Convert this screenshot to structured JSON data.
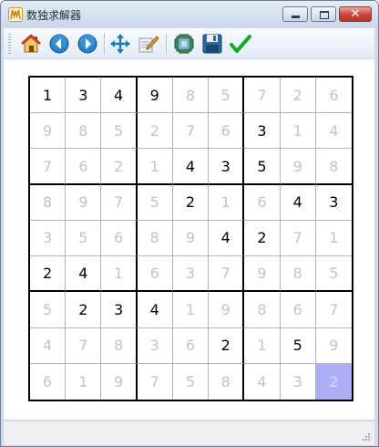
{
  "window": {
    "title": "数独求解器"
  },
  "toolbar": {
    "buttons": [
      {
        "name": "home-button",
        "icon": "home-icon"
      },
      {
        "name": "back-button",
        "icon": "back-arrow-icon"
      },
      {
        "name": "forward-button",
        "icon": "forward-arrow-icon"
      },
      {
        "name": "move-button",
        "icon": "move-icon"
      },
      {
        "name": "edit-button",
        "icon": "edit-icon"
      },
      {
        "name": "solve-button",
        "icon": "solve-icon"
      },
      {
        "name": "save-button",
        "icon": "floppy-disk-icon"
      },
      {
        "name": "check-button",
        "icon": "checkmark-icon"
      }
    ]
  },
  "board": {
    "cells": [
      [
        "1",
        "3",
        "4",
        "9",
        "8",
        "5",
        "7",
        "2",
        "6"
      ],
      [
        "9",
        "8",
        "5",
        "2",
        "7",
        "6",
        "3",
        "1",
        "4"
      ],
      [
        "7",
        "6",
        "2",
        "1",
        "4",
        "3",
        "5",
        "9",
        "8"
      ],
      [
        "8",
        "9",
        "7",
        "5",
        "2",
        "1",
        "6",
        "4",
        "3"
      ],
      [
        "3",
        "5",
        "6",
        "8",
        "9",
        "4",
        "2",
        "7",
        "1"
      ],
      [
        "2",
        "4",
        "1",
        "6",
        "3",
        "7",
        "9",
        "8",
        "5"
      ],
      [
        "5",
        "2",
        "3",
        "4",
        "1",
        "9",
        "8",
        "6",
        "7"
      ],
      [
        "4",
        "7",
        "8",
        "3",
        "6",
        "2",
        "1",
        "5",
        "9"
      ],
      [
        "6",
        "1",
        "9",
        "7",
        "5",
        "8",
        "4",
        "3",
        "2"
      ]
    ],
    "givens": [
      [
        1,
        1,
        1,
        1,
        0,
        0,
        0,
        0,
        0
      ],
      [
        0,
        0,
        0,
        0,
        0,
        0,
        1,
        0,
        0
      ],
      [
        0,
        0,
        0,
        0,
        1,
        1,
        1,
        0,
        0
      ],
      [
        0,
        0,
        0,
        0,
        1,
        0,
        0,
        1,
        1
      ],
      [
        0,
        0,
        0,
        0,
        0,
        1,
        1,
        0,
        0
      ],
      [
        1,
        1,
        0,
        0,
        0,
        0,
        0,
        0,
        0
      ],
      [
        0,
        1,
        1,
        1,
        0,
        0,
        0,
        0,
        0
      ],
      [
        0,
        0,
        0,
        0,
        0,
        1,
        0,
        1,
        0
      ],
      [
        0,
        0,
        0,
        0,
        0,
        0,
        0,
        0,
        0
      ]
    ],
    "selected": [
      8,
      8
    ],
    "colors": {
      "given": "#000000",
      "solved": "#c3c3c3",
      "selected_bg": "#aeaef7"
    }
  }
}
